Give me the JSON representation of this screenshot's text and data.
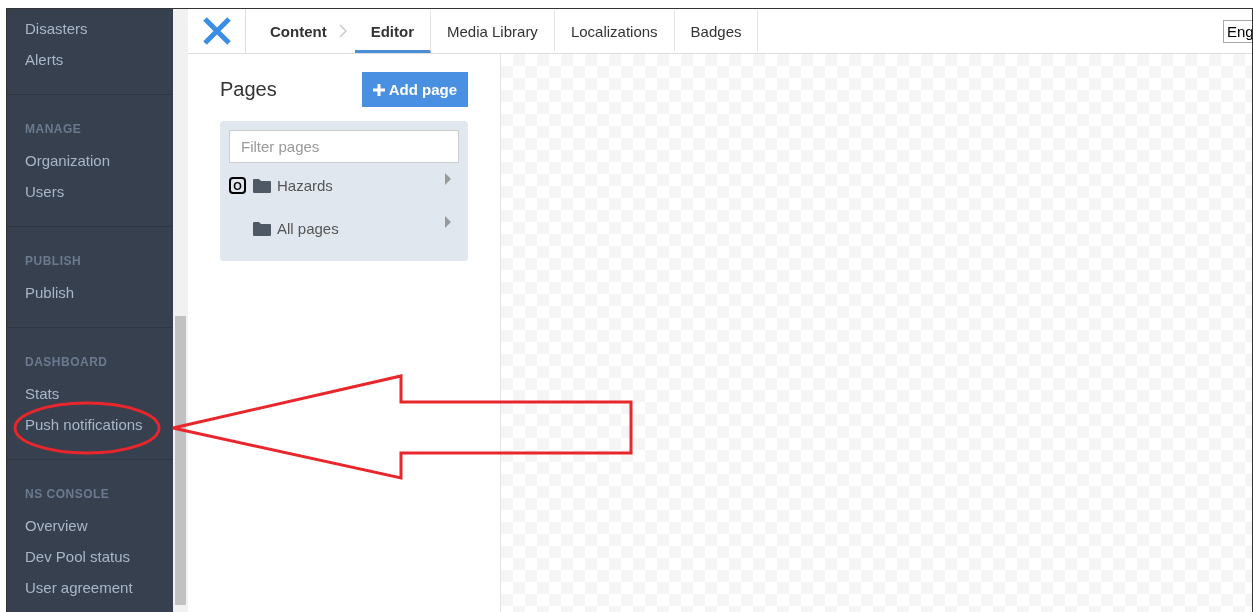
{
  "sidebar": {
    "groups": [
      {
        "items": [
          "Disasters",
          "Alerts"
        ]
      },
      {
        "heading": "MANAGE",
        "items": [
          "Organization",
          "Users"
        ]
      },
      {
        "heading": "PUBLISH",
        "items": [
          "Publish"
        ]
      },
      {
        "heading": "DASHBOARD",
        "items": [
          "Stats",
          "Push notifications"
        ]
      },
      {
        "heading": "NS CONSOLE",
        "items": [
          "Overview",
          "Dev Pool status",
          "User agreement"
        ]
      }
    ]
  },
  "topbar": {
    "tabs": [
      {
        "label": "Content",
        "selected": false,
        "kind": "crumb"
      },
      {
        "label": "Editor",
        "selected": true,
        "kind": "tab"
      },
      {
        "label": "Media Library",
        "selected": false,
        "kind": "tab"
      },
      {
        "label": "Localizations",
        "selected": false,
        "kind": "tab"
      },
      {
        "label": "Badges",
        "selected": false,
        "kind": "tab"
      }
    ],
    "language": "Eng"
  },
  "pages": {
    "title": "Pages",
    "add_button": "Add page",
    "filter": {
      "placeholder": "Filter pages"
    },
    "tree": [
      {
        "label": "Hazards",
        "badge": "O"
      },
      {
        "label": "All pages"
      }
    ]
  }
}
